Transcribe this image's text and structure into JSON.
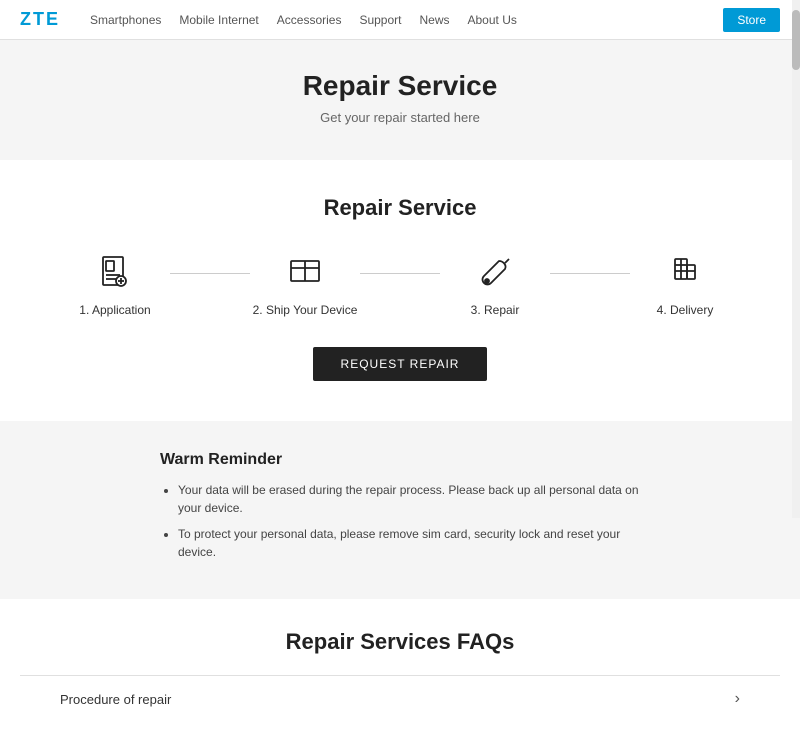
{
  "header": {
    "logo": "ZTE",
    "nav_items": [
      "Smartphones",
      "Mobile Internet",
      "Accessories",
      "Support",
      "News",
      "About Us"
    ],
    "store_button": "Store"
  },
  "hero": {
    "title": "Repair Service",
    "subtitle": "Get your repair started here"
  },
  "steps_section": {
    "title": "Repair Service",
    "steps": [
      {
        "label": "1. Application"
      },
      {
        "label": "2. Ship Your Device"
      },
      {
        "label": "3. Repair"
      },
      {
        "label": "4. Delivery"
      }
    ],
    "request_button": "REQUEST REPAIR"
  },
  "reminder": {
    "title": "Warm Reminder",
    "items": [
      "Your data will be erased during the repair process. Please back up all personal data on your device.",
      "To protect your personal data, please remove sim card, security lock and reset your device."
    ]
  },
  "faq": {
    "title": "Repair Services FAQs",
    "items": [
      {
        "label": "Procedure of repair"
      }
    ]
  }
}
